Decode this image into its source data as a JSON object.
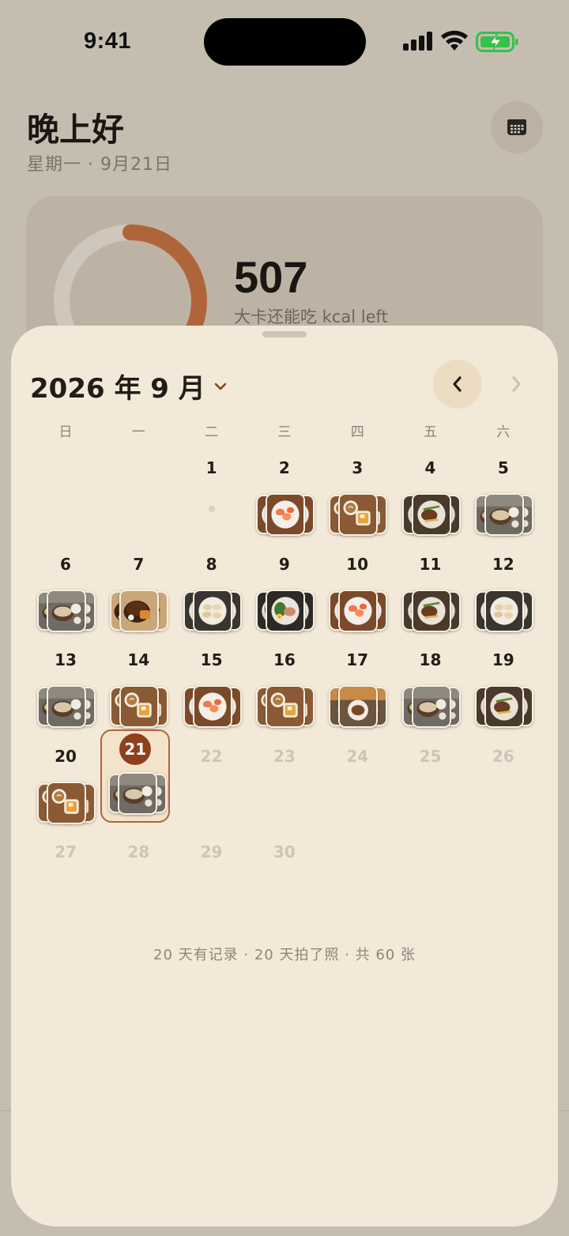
{
  "status_bar": {
    "time": "9:41"
  },
  "header": {
    "greeting": "晚上好",
    "date_line": "星期一 · 9月21日"
  },
  "summary": {
    "kcal_value": "507",
    "kcal_label": "大卡还能吃 kcal left",
    "ring_progress": 0.62
  },
  "colors": {
    "accent": "#b0643a",
    "today_badge": "#8e3f1c",
    "sheet_bg": "#f3e9d9",
    "page_bg": "#c6bdb1"
  },
  "calendar": {
    "month_title": "2026 年 9 月",
    "weekdays": [
      "日",
      "一",
      "二",
      "三",
      "四",
      "五",
      "六"
    ],
    "today": 21,
    "first_weekday_index": 2,
    "days_in_month": 30,
    "days": [
      {
        "day": 1,
        "photo": "none"
      },
      {
        "day": 2,
        "photo": "sushi"
      },
      {
        "day": 3,
        "photo": "coffee-toast"
      },
      {
        "day": 4,
        "photo": "steak"
      },
      {
        "day": 5,
        "photo": "ramen-table"
      },
      {
        "day": 6,
        "photo": "ramen-table"
      },
      {
        "day": 7,
        "photo": "curry"
      },
      {
        "day": 8,
        "photo": "dumplings"
      },
      {
        "day": 9,
        "photo": "salad"
      },
      {
        "day": 10,
        "photo": "sushi"
      },
      {
        "day": 11,
        "photo": "steak"
      },
      {
        "day": 12,
        "photo": "dumplings"
      },
      {
        "day": 13,
        "photo": "ramen-table"
      },
      {
        "day": 14,
        "photo": "coffee-toast"
      },
      {
        "day": 15,
        "photo": "sushi"
      },
      {
        "day": 16,
        "photo": "coffee-toast"
      },
      {
        "day": 17,
        "photo": "noodles"
      },
      {
        "day": 18,
        "photo": "ramen-table"
      },
      {
        "day": 19,
        "photo": "steak"
      },
      {
        "day": 20,
        "photo": "coffee-toast"
      },
      {
        "day": 21,
        "photo": "ramen-table"
      },
      {
        "day": 22,
        "photo": "future"
      },
      {
        "day": 23,
        "photo": "future"
      },
      {
        "day": 24,
        "photo": "future"
      },
      {
        "day": 25,
        "photo": "future"
      },
      {
        "day": 26,
        "photo": "future"
      },
      {
        "day": 27,
        "photo": "future"
      },
      {
        "day": 28,
        "photo": "future"
      },
      {
        "day": 29,
        "photo": "future"
      },
      {
        "day": 30,
        "photo": "future"
      }
    ]
  },
  "footer": {
    "stats": "20 天有记录 · 20 天拍了照 · 共 60 张"
  },
  "icons": {
    "calendar_button": "calendar-grid-icon",
    "month_dropdown": "chevron-down-icon",
    "prev": "chevron-left-icon",
    "next": "chevron-right-icon"
  }
}
